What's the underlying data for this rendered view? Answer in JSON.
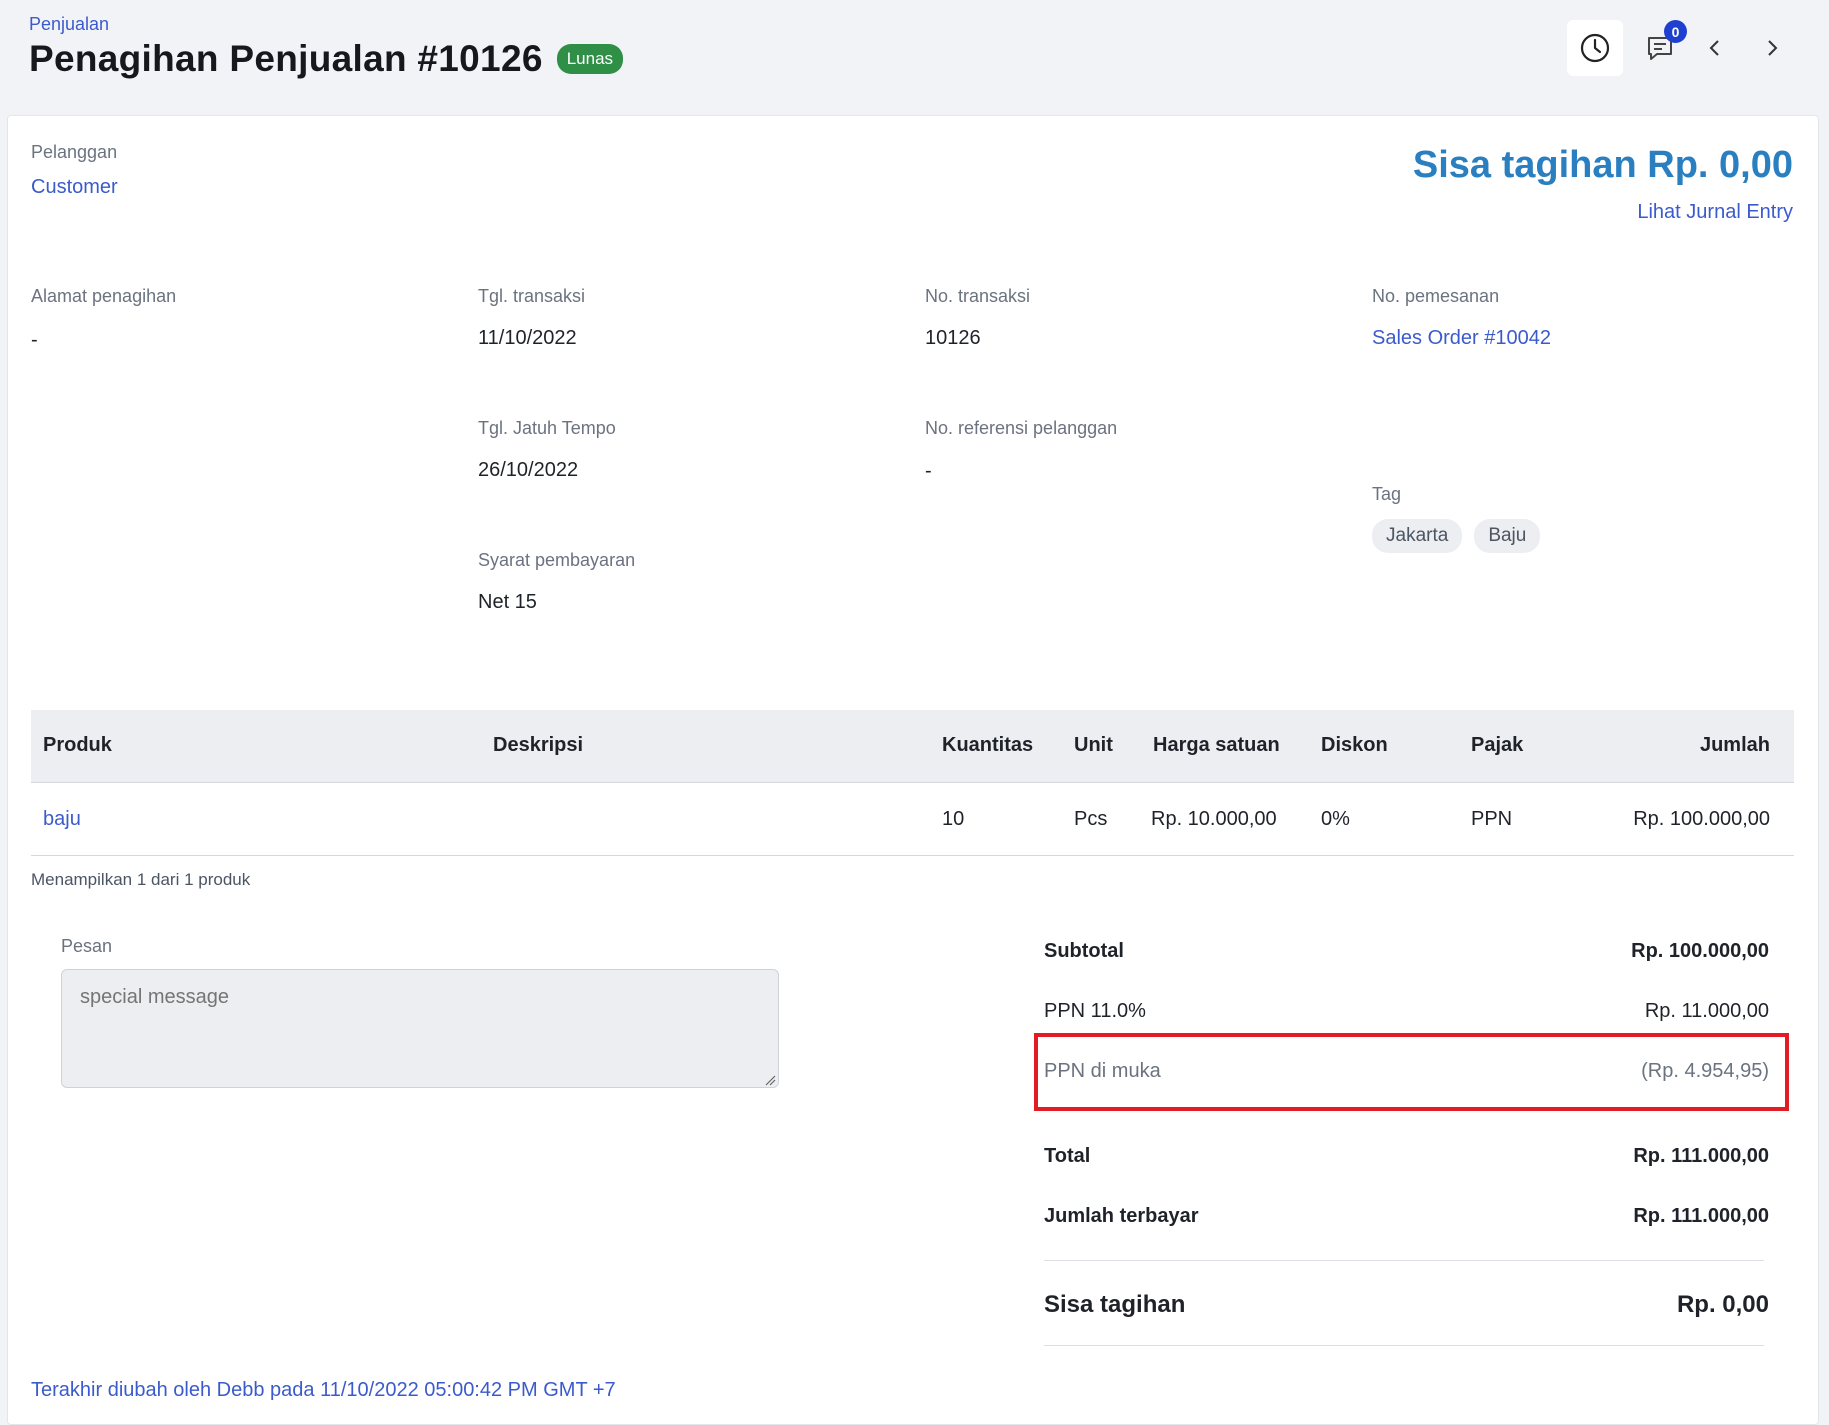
{
  "header": {
    "breadcrumb": "Penjualan",
    "title": "Penagihan Penjualan #10126",
    "status_badge": "Lunas",
    "comment_count": "0"
  },
  "summary_top": {
    "remaining_label": "Sisa tagihan Rp. 0,00",
    "journal_link": "Lihat Jurnal Entry"
  },
  "customer": {
    "label": "Pelanggan",
    "value": "Customer"
  },
  "fields": {
    "billing_address": {
      "label": "Alamat penagihan",
      "value": "-"
    },
    "transaction_date": {
      "label": "Tgl. transaksi",
      "value": "11/10/2022"
    },
    "transaction_no": {
      "label": "No. transaksi",
      "value": "10126"
    },
    "order_no": {
      "label": "No. pemesanan",
      "value": "Sales Order #10042"
    },
    "due_date": {
      "label": "Tgl. Jatuh Tempo",
      "value": "26/10/2022"
    },
    "customer_ref": {
      "label": "No. referensi pelanggan",
      "value": "-"
    },
    "payment_terms": {
      "label": "Syarat pembayaran",
      "value": "Net 15"
    },
    "tag": {
      "label": "Tag",
      "values": [
        "Jakarta",
        "Baju"
      ]
    }
  },
  "table": {
    "headers": [
      "Produk",
      "Deskripsi",
      "Kuantitas",
      "Unit",
      "Harga satuan",
      "Diskon",
      "Pajak",
      "Jumlah"
    ],
    "rows": [
      {
        "product": "baju",
        "description": "",
        "qty": "10",
        "unit": "Pcs",
        "price": "Rp. 10.000,00",
        "discount": "0%",
        "tax": "PPN",
        "amount": "Rp. 100.000,00"
      }
    ],
    "showing": "Menampilkan 1 dari 1 produk"
  },
  "message": {
    "label": "Pesan",
    "placeholder": "special message"
  },
  "totals": {
    "subtotal": {
      "label": "Subtotal",
      "value": "Rp. 100.000,00"
    },
    "ppn": {
      "label": "PPN 11.0%",
      "value": "Rp. 11.000,00"
    },
    "ppn_advance": {
      "label": "PPN di muka",
      "value": "(Rp. 4.954,95)"
    },
    "total": {
      "label": "Total",
      "value": "Rp. 111.000,00"
    },
    "paid": {
      "label": "Jumlah terbayar",
      "value": "Rp. 111.000,00"
    },
    "remaining": {
      "label": "Sisa tagihan",
      "value": "Rp. 0,00"
    }
  },
  "footer": "Terakhir diubah oleh Debb pada 11/10/2022 05:00:42 PM GMT +7",
  "colors": {
    "accent": "#3b5bcc",
    "status_paid": "#2f8f46",
    "highlight": "#e31b23",
    "title_blue": "#2a7fc1"
  },
  "icons": [
    "history-icon",
    "comment-icon",
    "chevron-left-icon",
    "chevron-right-icon"
  ]
}
